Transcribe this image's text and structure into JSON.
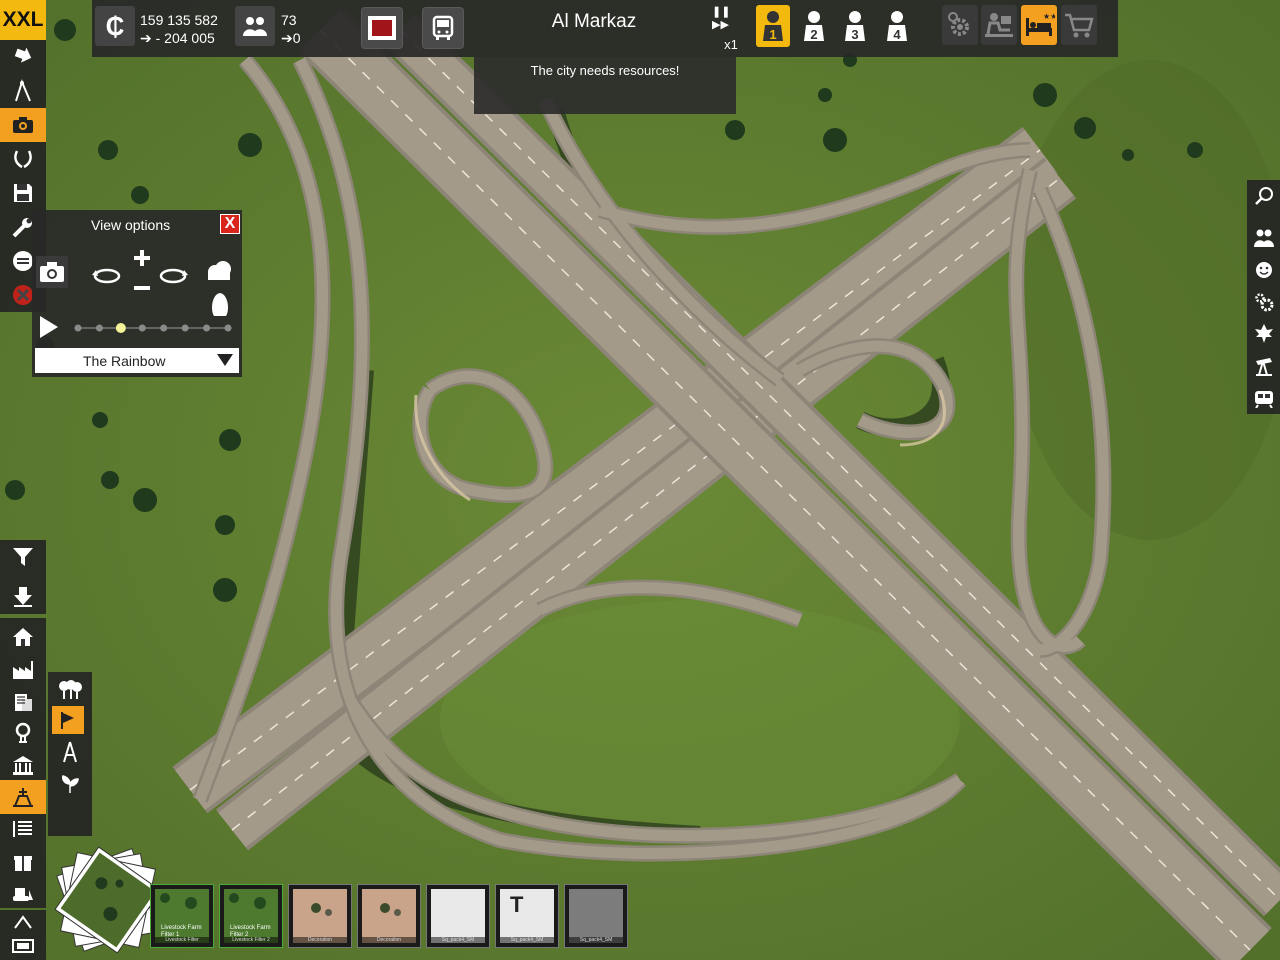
{
  "top_bar": {
    "money": "159 135 582",
    "money_change": "- 204 005",
    "population": "73",
    "population_change": "0",
    "city_name": "Al Markaz",
    "game_speed": "x1",
    "players": [
      "1",
      "2",
      "3",
      "4"
    ],
    "active_player": "1"
  },
  "notification": {
    "text": "The city needs resources!"
  },
  "left_toolbar": {
    "logo_label": "XXL",
    "items": [
      "move-icon",
      "road-tool-icon",
      "camera-icon",
      "laurel-icon",
      "save-icon",
      "wrench-icon",
      "connect-icon",
      "close-icon"
    ],
    "active_item": "camera-icon"
  },
  "view_options": {
    "title": "View options",
    "close_label": "X",
    "time_slider_steps": 8,
    "time_slider_value": 3,
    "skybox_selected": "The Rainbow"
  },
  "build_toolbar": {
    "items": [
      "filter-icon",
      "download-icon",
      "house-icon",
      "factory-icon",
      "office-icon",
      "service-icon",
      "civic-icon",
      "landmark-icon",
      "list-icon",
      "gift-icon",
      "bulldozer-icon"
    ],
    "active_item": "landmark-icon",
    "sub_items": [
      "trees-icon",
      "flag-icon",
      "tower-icon",
      "plant-icon"
    ],
    "active_sub_item": "flag-icon"
  },
  "right_toolbar": {
    "items": [
      "search-icon",
      "people-icon",
      "smile-icon",
      "gears-icon",
      "leaf-icon",
      "oil-pump-icon",
      "train-icon"
    ]
  },
  "assets": [
    {
      "title": "Livestock Farm Filter 1",
      "caption": "Livestock Filter",
      "kind": "grass"
    },
    {
      "title": "Livestock Farm Filter 2",
      "caption": "Livestock Filter 2",
      "kind": "grass"
    },
    {
      "title": "",
      "caption": "Decoration",
      "kind": "dirt"
    },
    {
      "title": "",
      "caption": "Decoration",
      "kind": "dirt"
    },
    {
      "title": "",
      "caption": "Sq_pack4_SM",
      "kind": "white"
    },
    {
      "title": "T",
      "caption": "Sq_pack4_SM",
      "kind": "white-t"
    },
    {
      "title": "",
      "caption": "Sq_pack4_SM",
      "kind": "gray"
    }
  ],
  "colors": {
    "grass": "#5d7a2e",
    "road": "#9a9182",
    "road_line": "#ece6d8",
    "accent": "#f3b90f",
    "panel": "#2a2a2a",
    "close": "#d8261c"
  }
}
